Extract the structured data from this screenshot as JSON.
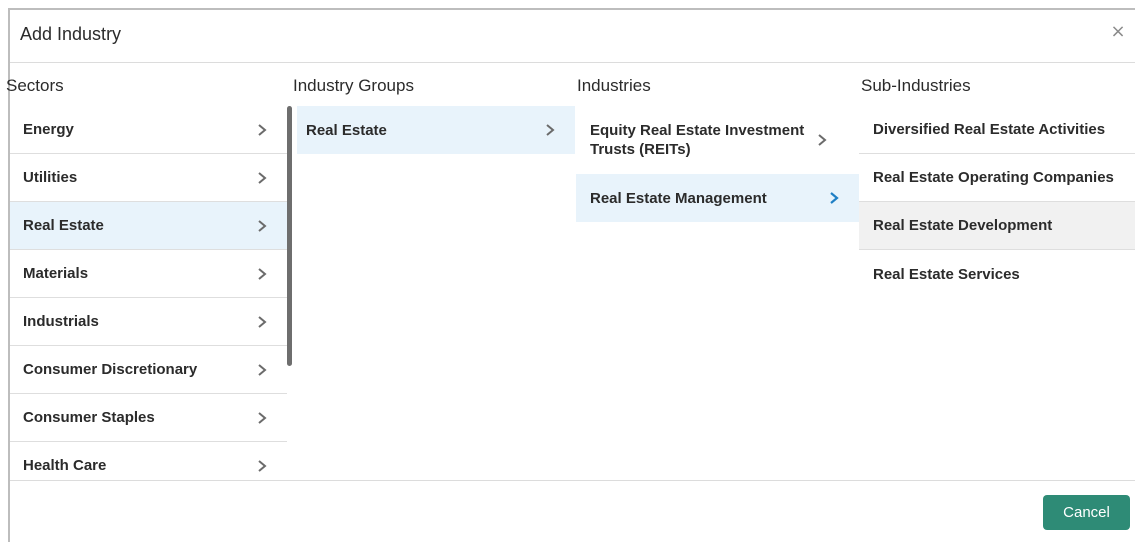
{
  "dialog": {
    "title": "Add Industry",
    "close_symbol": "×",
    "cancel_label": "Cancel"
  },
  "columns": {
    "sectors": "Sectors",
    "groups": "Industry Groups",
    "industries": "Industries",
    "sub_industries": "Sub-Industries"
  },
  "sectors": [
    {
      "label": "Energy"
    },
    {
      "label": "Utilities"
    },
    {
      "label": "Real Estate"
    },
    {
      "label": "Materials"
    },
    {
      "label": "Industrials"
    },
    {
      "label": "Consumer Discretionary"
    },
    {
      "label": "Consumer Staples"
    },
    {
      "label": "Health Care"
    }
  ],
  "groups": [
    {
      "label": "Real Estate"
    }
  ],
  "industries": [
    {
      "label": "Equity Real Estate Investment Trusts (REITs)"
    },
    {
      "label": "Real Estate Management"
    }
  ],
  "sub_industries": [
    {
      "label": "Diversified Real Estate Activities"
    },
    {
      "label": "Real Estate Operating Companies"
    },
    {
      "label": "Real Estate Development"
    },
    {
      "label": "Real Estate Services"
    }
  ],
  "selection": {
    "sector": "Real Estate",
    "group": "Real Estate",
    "industry": "Real Estate Management",
    "hovered_sub_industry": "Real Estate Development"
  },
  "colors": {
    "accent": "#2e8b76",
    "selected_bg": "#e8f3fb",
    "active_chevron": "#1f7fc4",
    "chevron": "#6b6b6b"
  },
  "icons": {
    "chevron": "chevron-right-icon",
    "close": "close-icon"
  }
}
